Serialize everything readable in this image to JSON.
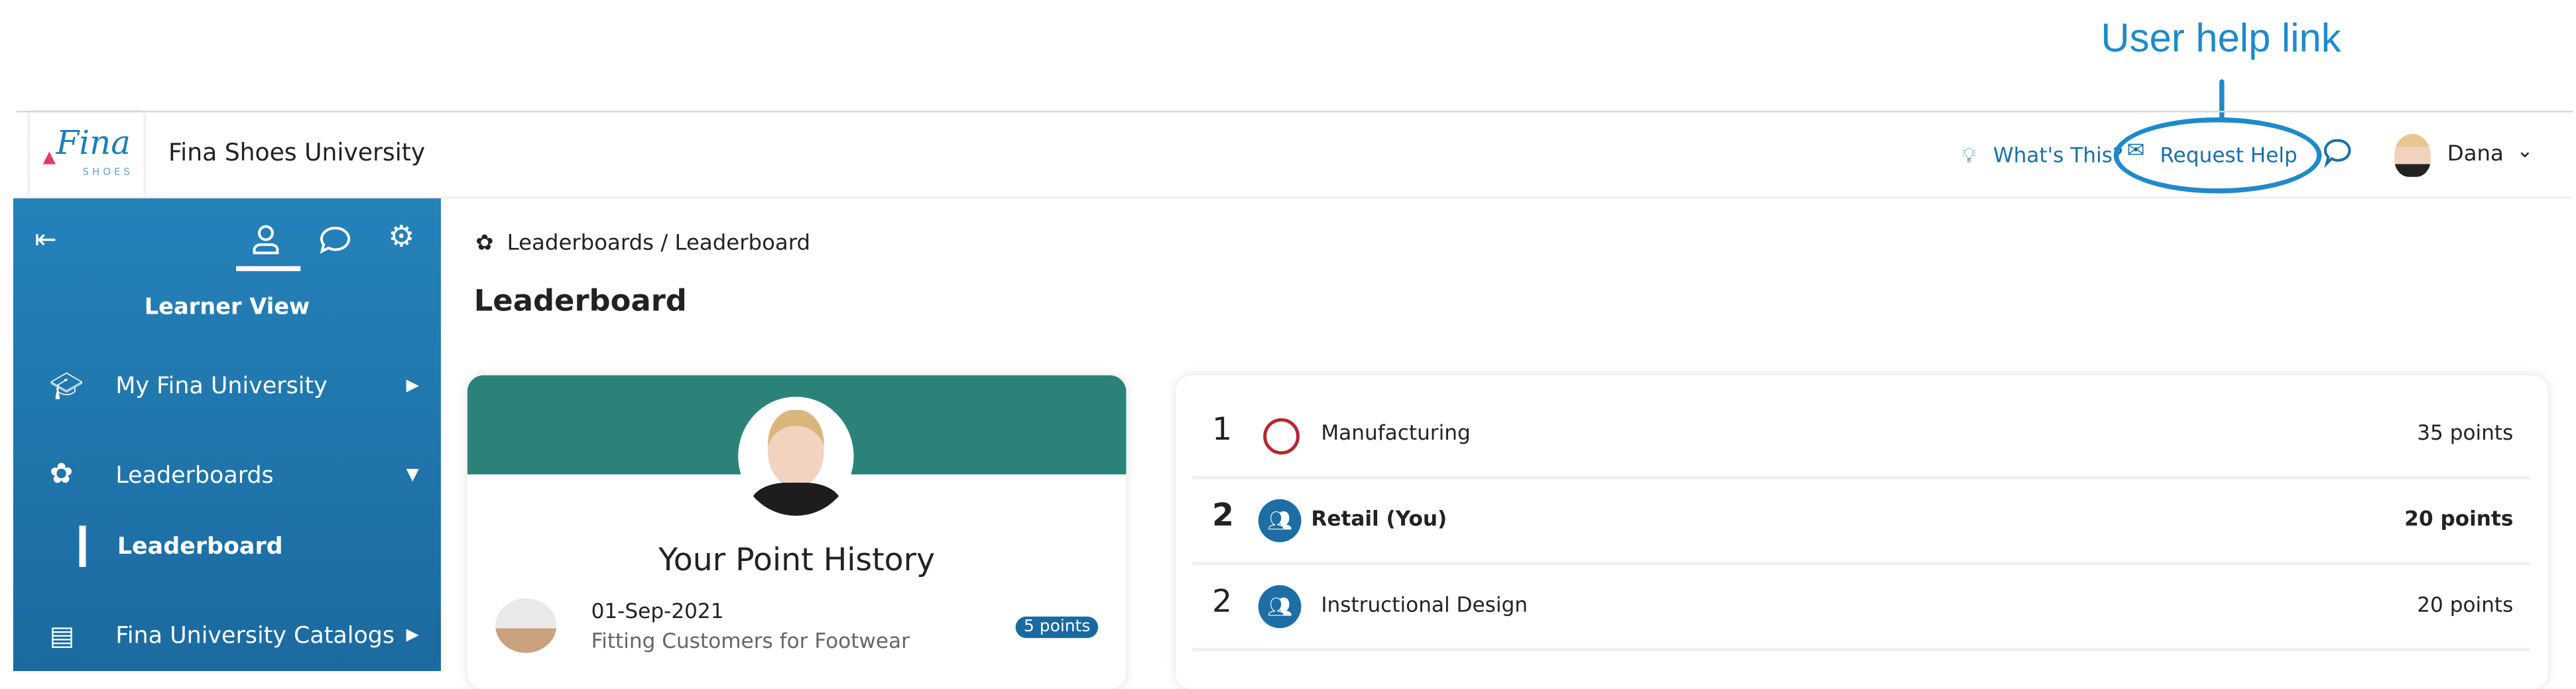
{
  "annotation": {
    "label": "User help link",
    "color": "#1f8acb"
  },
  "header": {
    "site_title": "Fina Shoes University",
    "logo_text": "Fina",
    "logo_sub": "SHOES",
    "whats_this": "What's This?",
    "request_help": "Request Help",
    "user_name": "Dana"
  },
  "sidebar": {
    "view_label": "Learner View",
    "items": [
      {
        "label": "My Fina University",
        "icon": "graduation-cap-icon",
        "arrow": "right"
      },
      {
        "label": "Leaderboards",
        "icon": "badge-icon",
        "arrow": "down"
      },
      {
        "label": "Leaderboard",
        "active": true
      },
      {
        "label": "Fina University Catalogs",
        "icon": "book-icon",
        "arrow": "right"
      }
    ]
  },
  "main": {
    "breadcrumb": "Leaderboards / Leaderboard",
    "title": "Leaderboard",
    "point_history": {
      "title": "Your Point History",
      "items": [
        {
          "date": "01-Sep-2021",
          "course": "Fitting Customers for Footwear",
          "points": "5 points"
        }
      ]
    },
    "leaderboard": [
      {
        "rank": "1",
        "name": "Manufacturing",
        "points": "35 points",
        "you": false,
        "icon_color": "#b8262f"
      },
      {
        "rank": "2",
        "name": "Retail (You)",
        "points": "20 points",
        "you": true,
        "icon_color": "#1c6ea4"
      },
      {
        "rank": "2",
        "name": "Instructional Design",
        "points": "20 points",
        "you": false,
        "icon_color": "#1c6ea4"
      }
    ]
  },
  "colors": {
    "sidebar": "#2280b8",
    "card_header": "#2b8279",
    "badge": "#1a6aa0"
  }
}
